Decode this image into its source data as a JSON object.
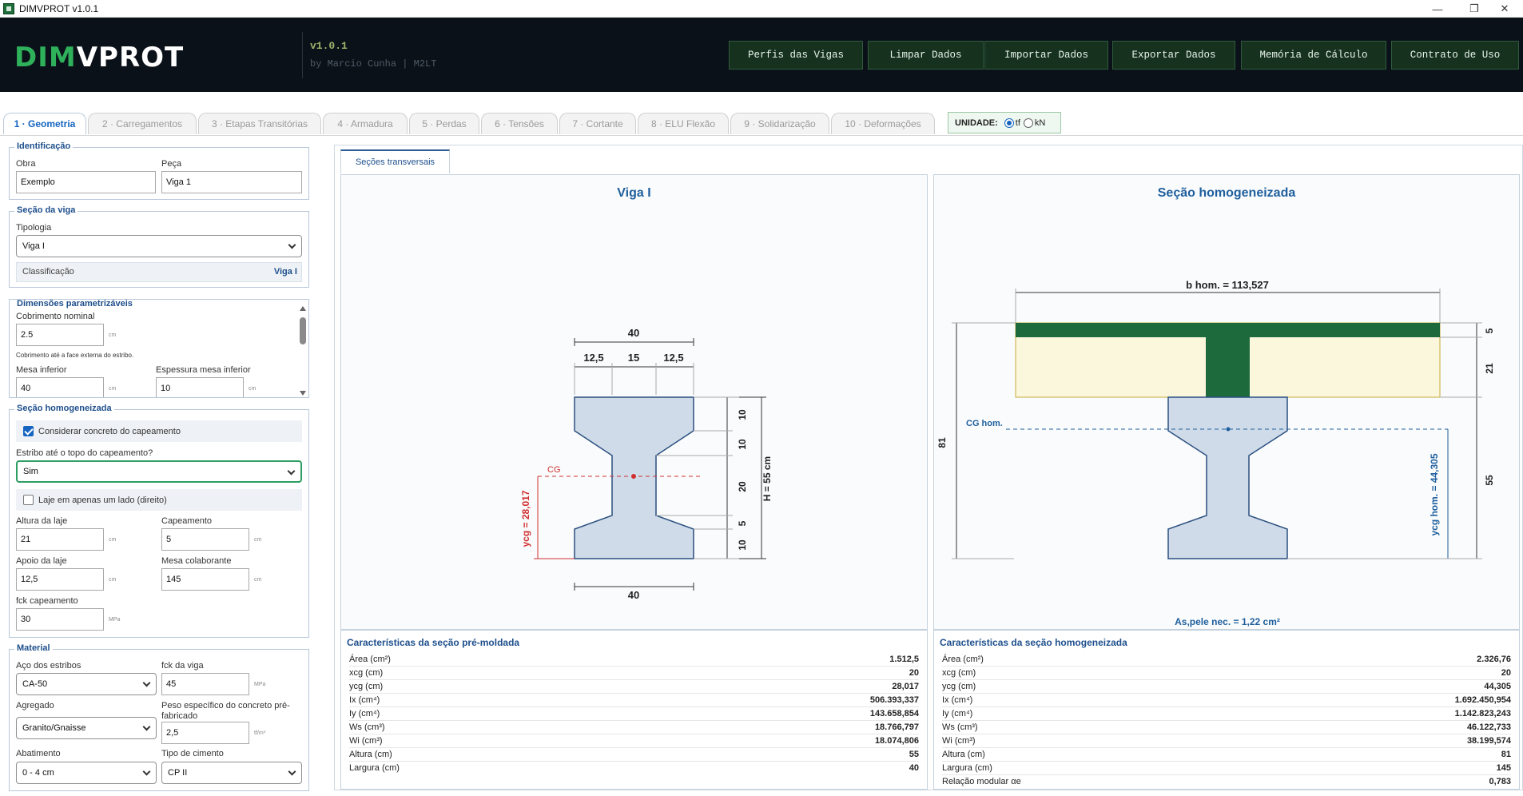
{
  "window": {
    "title": "DIMVPROT v1.0.1",
    "minimize": "—",
    "restore": "❐",
    "close": "✕"
  },
  "header": {
    "logo_a": "DIM",
    "logo_b": "VPROT",
    "version": "v1.0.1",
    "byline": "by Marcio Cunha  |  M2LT",
    "buttons": [
      "Perfis das Vigas",
      "Limpar Dados",
      "Importar Dados",
      "Exportar Dados",
      "Memória de Cálculo",
      "Contrato de Uso"
    ]
  },
  "tabs": [
    "1 · Geometria",
    "2 · Carregamentos",
    "3 · Etapas Transitórias",
    "4 · Armadura",
    "5 · Perdas",
    "6 · Tensões",
    "7 · Cortante",
    "8 · ELU Flexão",
    "9 · Solidarização",
    "10 · Deformações"
  ],
  "unit": {
    "label": "UNIDADE:",
    "options": [
      "tf",
      "kN"
    ],
    "selected": "tf"
  },
  "identificacao": {
    "legend": "Identificação",
    "obra_label": "Obra",
    "obra_value": "Exemplo",
    "peca_label": "Peça",
    "peca_value": "Viga 1"
  },
  "secao_viga": {
    "legend": "Seção da viga",
    "tipologia_label": "Tipologia",
    "tipologia_value": "Viga I",
    "classificacao_label": "Classificação",
    "classificacao_value": "Viga I"
  },
  "dimensoes": {
    "legend": "Dimensões parametrizáveis",
    "cobrimento_label": "Cobrimento nominal",
    "cobrimento_value": "2.5",
    "cobrimento_unit": "cm",
    "cobrimento_hint": "Cobrimento até a face externa do estribo.",
    "mesa_inf_label": "Mesa inferior",
    "mesa_inf_value": "40",
    "mesa_inf_unit": "cm",
    "esp_mesa_label": "Espessura mesa inferior",
    "esp_mesa_value": "10",
    "esp_mesa_unit": "cm"
  },
  "secao_homog": {
    "legend": "Seção homogeneizada",
    "considerar_label": "Considerar concreto do capeamento",
    "considerar_checked": true,
    "estribo_label": "Estribo até o topo do capeamento?",
    "estribo_value": "Sim",
    "laje_lado_label": "Laje em apenas um lado (direito)",
    "laje_lado_checked": false,
    "altura_laje_label": "Altura da laje",
    "altura_laje_value": "21",
    "altura_laje_unit": "cm",
    "capeamento_label": "Capeamento",
    "capeamento_value": "5",
    "capeamento_unit": "cm",
    "apoio_laje_label": "Apoio da laje",
    "apoio_laje_value": "12,5",
    "apoio_laje_unit": "cm",
    "mesa_colab_label": "Mesa colaborante",
    "mesa_colab_value": "145",
    "mesa_colab_unit": "cm",
    "fck_cap_label": "fck capeamento",
    "fck_cap_value": "30",
    "fck_cap_unit": "MPa"
  },
  "material": {
    "legend": "Material",
    "aco_label": "Aço dos estribos",
    "aco_value": "CA-50",
    "fck_label": "fck da viga",
    "fck_value": "45",
    "fck_unit": "MPa",
    "agregado_label": "Agregado",
    "agregado_value": "Granito/Gnaisse",
    "peso_label": "Peso específico do concreto pré-fabricado",
    "peso_value": "2,5",
    "peso_unit": "tf/m³",
    "abatimento_label": "Abatimento",
    "abatimento_value": "0 - 4 cm",
    "cimento_label": "Tipo de cimento",
    "cimento_value": "CP II"
  },
  "subtab": "Seções transversais",
  "viga_i": {
    "title": "Viga I",
    "dim_top": "40",
    "dim_a": "12,5",
    "dim_b": "15",
    "dim_c": "12,5",
    "dim_bottom": "40",
    "h_label": "H = 55 cm",
    "cg_label": "CG",
    "ycg_label": "ycg = 28,017",
    "v1": "10",
    "v2": "10",
    "v3": "20",
    "v4": "5",
    "v5": "10"
  },
  "homog": {
    "title": "Seção homogeneizada",
    "b_label": "b hom. = 113,527",
    "cg_label": "CG hom.",
    "ycg_label": "ycg hom. = 44,305",
    "h_total": "81",
    "r1": "5",
    "r2": "21",
    "r3": "55",
    "as_pele": "As,pele nec. = 1,22 cm²"
  },
  "props_pre": {
    "title": "Características da seção pré-moldada",
    "rows": [
      {
        "k": "Área (cm²)",
        "v": "1.512,5"
      },
      {
        "k": "xcg (cm)",
        "v": "20"
      },
      {
        "k": "ycg (cm)",
        "v": "28,017"
      },
      {
        "k": "Ix (cm⁴)",
        "v": "506.393,337"
      },
      {
        "k": "Iy (cm⁴)",
        "v": "143.658,854"
      },
      {
        "k": "Ws (cm³)",
        "v": "18.766,797"
      },
      {
        "k": "Wi (cm³)",
        "v": "18.074,806"
      },
      {
        "k": "Altura (cm)",
        "v": "55"
      },
      {
        "k": "Largura (cm)",
        "v": "40"
      }
    ]
  },
  "props_hom": {
    "title": "Características da seção homogeneizada",
    "rows": [
      {
        "k": "Área (cm²)",
        "v": "2.326,76"
      },
      {
        "k": "xcg (cm)",
        "v": "20"
      },
      {
        "k": "ycg (cm)",
        "v": "44,305"
      },
      {
        "k": "Ix (cm⁴)",
        "v": "1.692.450,954"
      },
      {
        "k": "Iy (cm⁴)",
        "v": "1.142.823,243"
      },
      {
        "k": "Ws (cm³)",
        "v": "46.122,733"
      },
      {
        "k": "Wi (cm³)",
        "v": "38.199,574"
      },
      {
        "k": "Altura (cm)",
        "v": "81"
      },
      {
        "k": "Largura (cm)",
        "v": "145"
      },
      {
        "k": "Relação modular αe",
        "v": "0,783"
      }
    ]
  },
  "colors": {
    "accent_green": "#2fb05a",
    "header_bg": "#0b1119",
    "title_blue": "#1e5f9e",
    "section_fill": "#cfdbe8",
    "slab_green": "#1d6b3d",
    "slab_fill": "#fbf7dc",
    "cg_red": "#d03030"
  }
}
